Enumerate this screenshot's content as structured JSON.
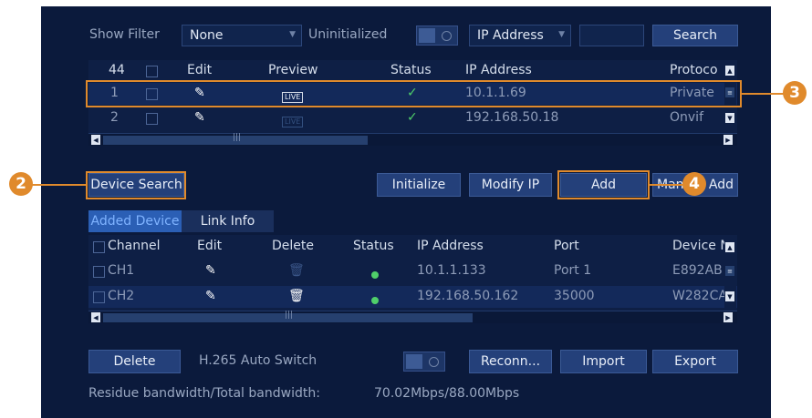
{
  "filter": {
    "show_filter_label": "Show Filter",
    "filter_value": "None",
    "uninitialized_label": "Uninitialized",
    "field_value": "IP Address",
    "search_value": "",
    "search_button": "Search"
  },
  "device_table": {
    "count_header": "44",
    "headers": {
      "edit": "Edit",
      "preview": "Preview",
      "status": "Status",
      "ip": "IP Address",
      "protocol": "Protoco"
    },
    "rows": [
      {
        "no": "1",
        "preview": "LIVE",
        "status": "✓",
        "ip": "10.1.1.69",
        "protocol": "Private"
      },
      {
        "no": "2",
        "preview": "LIVE",
        "status": "✓",
        "ip": "192.168.50.18",
        "protocol": "Onvif"
      }
    ]
  },
  "actions": {
    "device_search": "Device Search",
    "initialize": "Initialize",
    "modify_ip": "Modify IP",
    "add": "Add",
    "manual_add_left": "Man",
    "manual_add_right": "Add"
  },
  "tabs": {
    "added_device": "Added Device",
    "link_info": "Link Info"
  },
  "added_table": {
    "headers": {
      "channel": "Channel",
      "edit": "Edit",
      "delete": "Delete",
      "status": "Status",
      "ip": "IP Address",
      "port": "Port",
      "device": "Device N"
    },
    "rows": [
      {
        "channel": "CH1",
        "ip": "10.1.1.133",
        "port": "Port 1",
        "device": "E892AB"
      },
      {
        "channel": "CH2",
        "ip": "192.168.50.162",
        "port": "35000",
        "device": "W282CA"
      }
    ]
  },
  "footer": {
    "delete": "Delete",
    "h265_label": "H.265 Auto Switch",
    "reconnect": "Reconn...",
    "import": "Import",
    "export": "Export",
    "bandwidth_label": "Residue bandwidth/Total bandwidth:",
    "bandwidth_value": "70.02Mbps/88.00Mbps"
  },
  "callouts": {
    "two": "2",
    "three": "3",
    "four": "4"
  },
  "colors": {
    "panel": "#0b1a3c",
    "button": "#24407a",
    "highlight": "#e08a2c",
    "status_online": "#4fcf6a",
    "active_tab": "#3d7ad6"
  },
  "icons": [
    "pencil-icon",
    "trash-icon",
    "check-icon",
    "live-icon",
    "scroll-arrow-icon"
  ]
}
